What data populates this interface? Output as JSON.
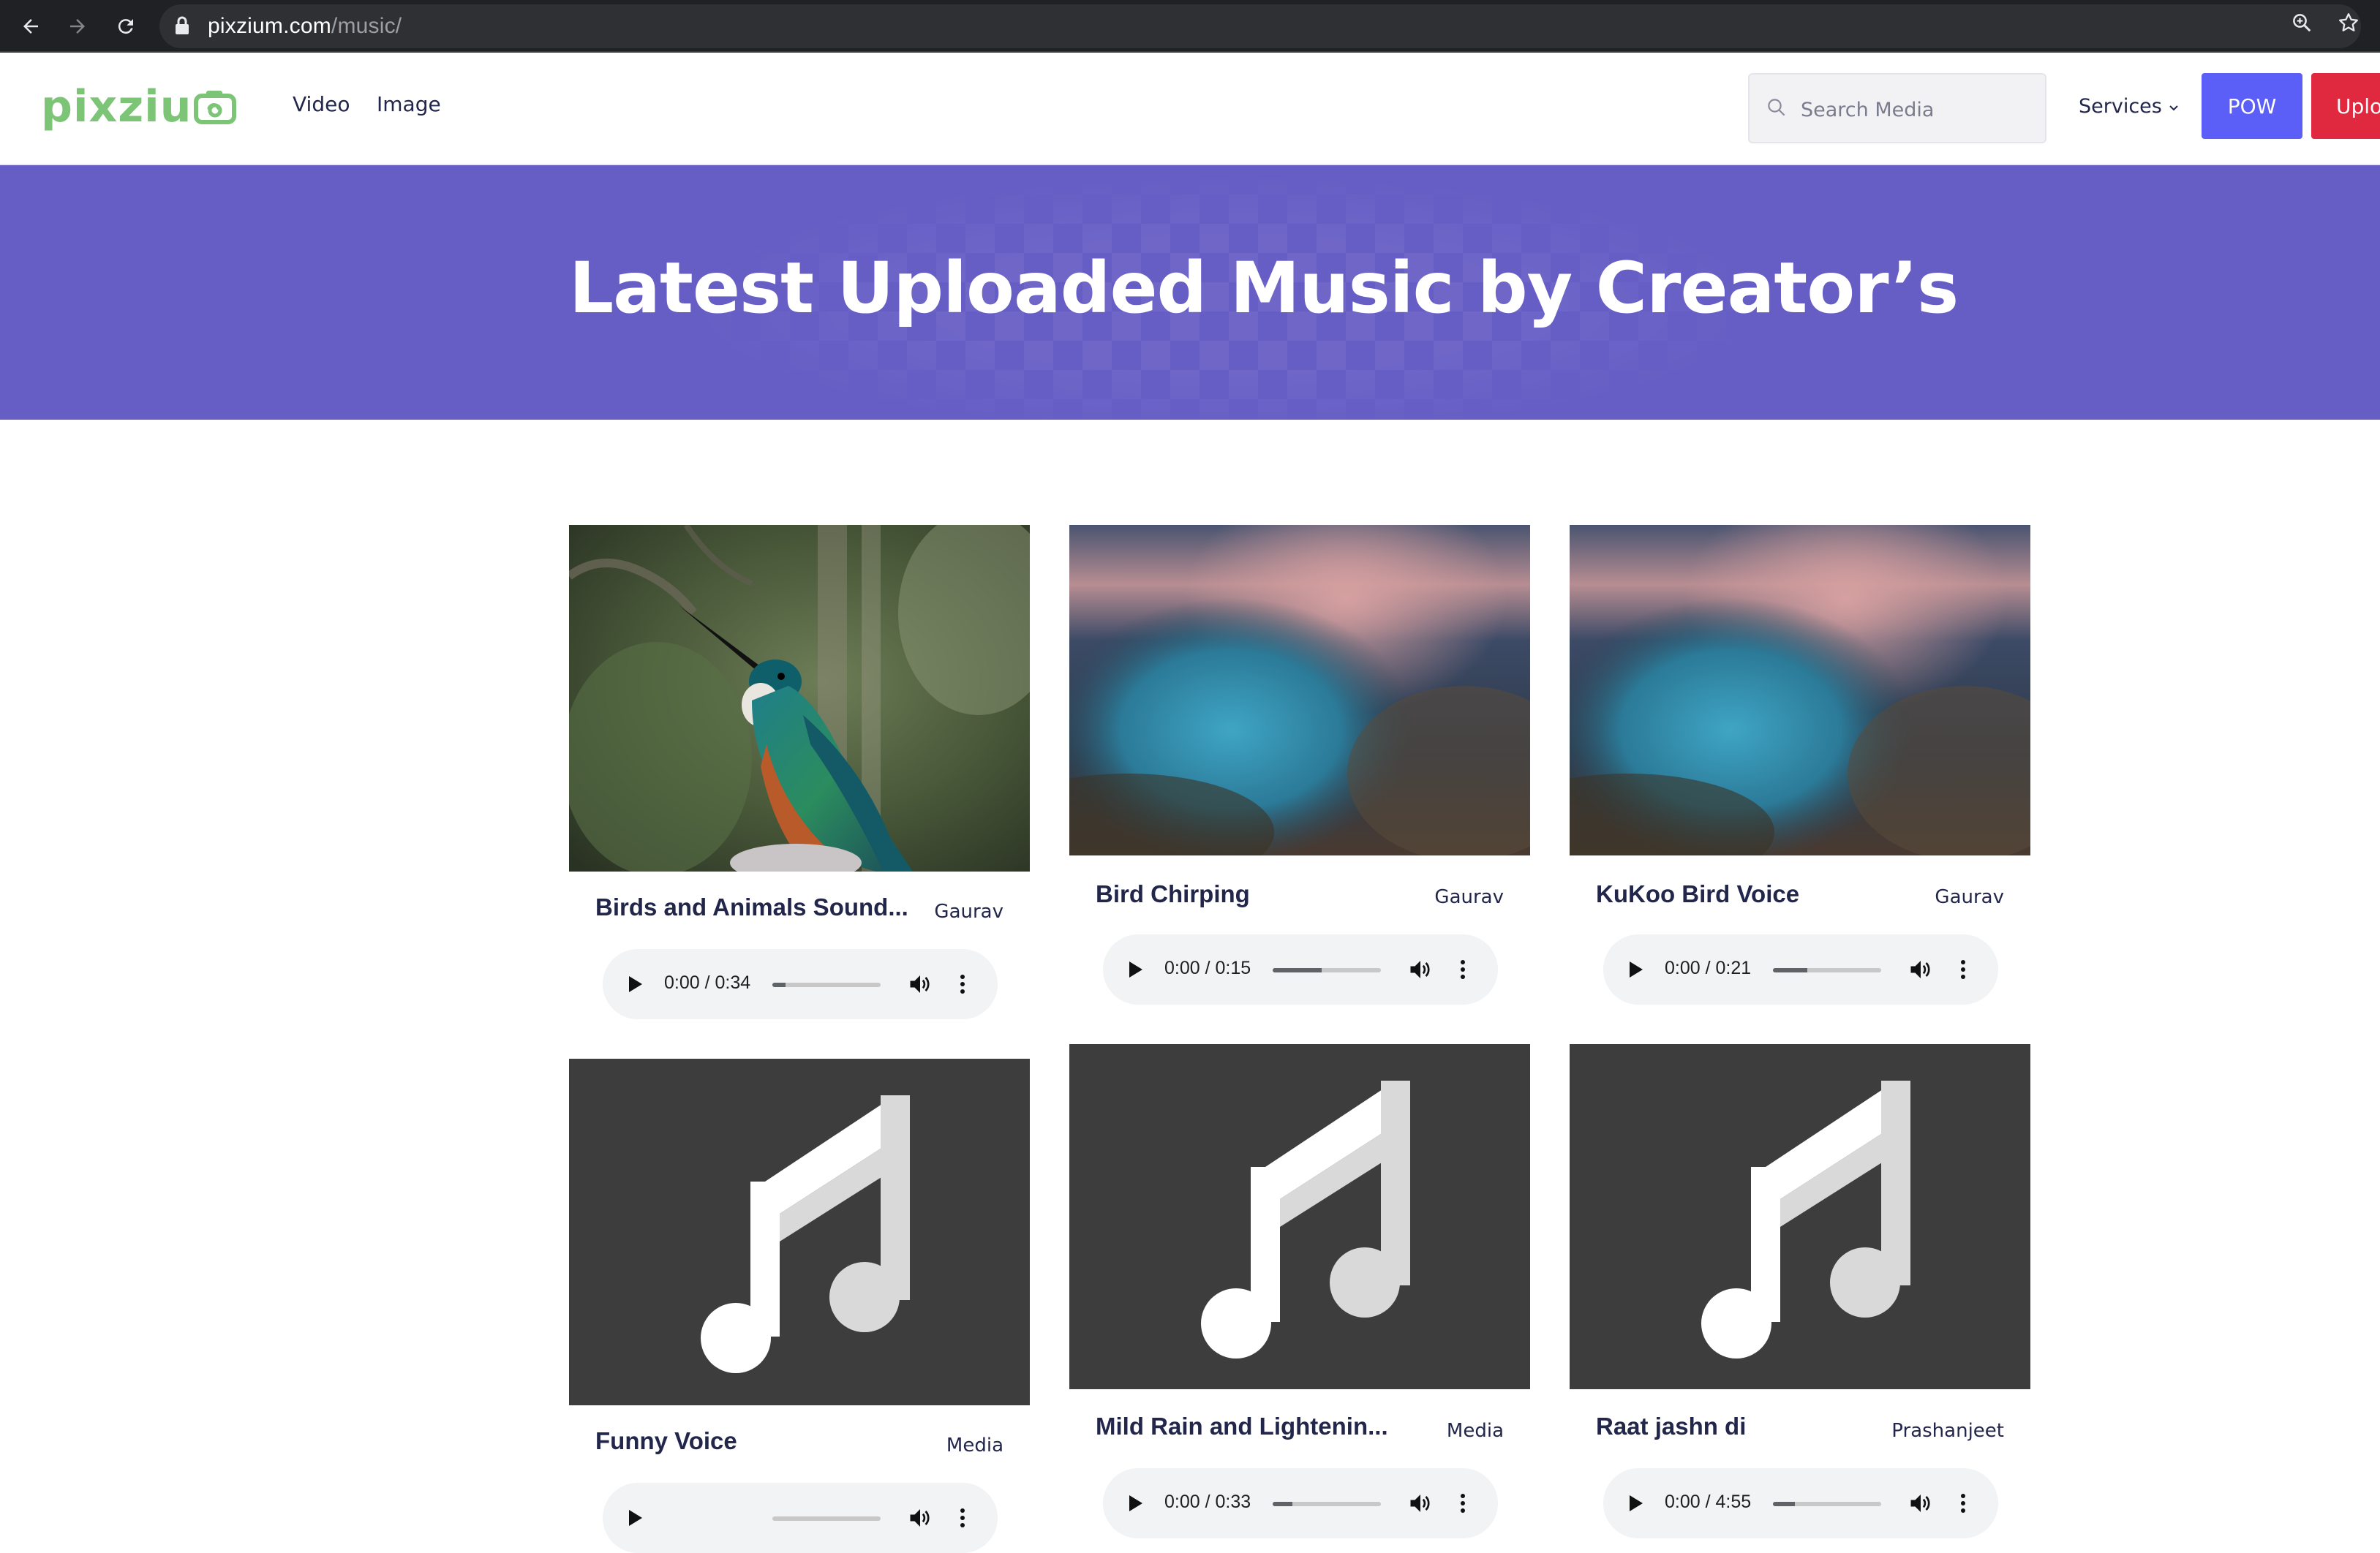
{
  "browser": {
    "url_domain": "pixzium.com",
    "url_path": "/music/"
  },
  "header": {
    "logo_text": "pixziu",
    "nav": [
      "Video",
      "Image"
    ],
    "search_placeholder": "Search Media",
    "services_label": "Services",
    "pow_label": "POW",
    "upload_label": "Uplo"
  },
  "banner": {
    "title": "Latest Uploaded Music by Creator’s"
  },
  "colors": {
    "banner": "#665dc5",
    "logo": "#7cc576",
    "pow_button": "#5b5ef7",
    "upload_button": "#e0283f"
  },
  "cards": [
    {
      "title": "Birds and Animals Sound...",
      "author": "Gaurav",
      "time": "0:00 / 0:34",
      "buffered": 0.12,
      "thumb": "hummingbird-photo"
    },
    {
      "title": "Bird Chirping",
      "author": "Gaurav",
      "time": "0:00 / 0:15",
      "buffered": 0.45,
      "thumb": "blurred-landscape"
    },
    {
      "title": "KuKoo Bird Voice",
      "author": "Gaurav",
      "time": "0:00 / 0:21",
      "buffered": 0.32,
      "thumb": "blurred-landscape"
    },
    {
      "title": "Funny Voice",
      "author": "Media",
      "time": "",
      "buffered": 0,
      "thumb": "music-note-icon"
    },
    {
      "title": "Mild Rain and Lightenin...",
      "author": "Media",
      "time": "0:00 / 0:33",
      "buffered": 0.18,
      "thumb": "music-note-icon"
    },
    {
      "title": "Raat jashn di",
      "author": "Prashanjeet",
      "time": "0:00 / 4:55",
      "buffered": 0.2,
      "thumb": "music-note-icon"
    }
  ]
}
